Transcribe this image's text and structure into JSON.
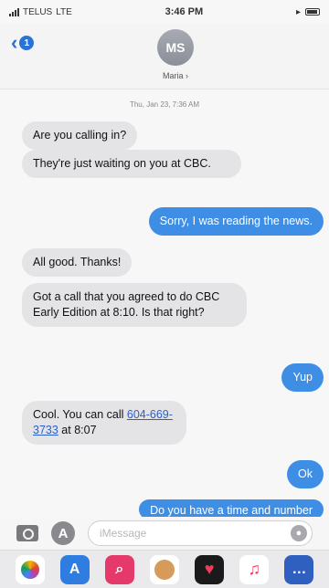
{
  "status_bar": {
    "carrier": "TELUS",
    "network": "LTE",
    "time": "3:46 PM"
  },
  "header": {
    "back_badge": "1",
    "avatar_initials": "MS",
    "contact_name": "Maria"
  },
  "timestamp": "Thu, Jan 23, 7:36 AM",
  "messages": [
    {
      "direction": "in",
      "text": "Are you calling in?"
    },
    {
      "direction": "in",
      "text": "They're just waiting on you at CBC."
    },
    {
      "direction": "out",
      "text": "Sorry, I was reading the news."
    },
    {
      "direction": "in",
      "text": "All good. Thanks!"
    },
    {
      "direction": "in",
      "text": "Got a call that you agreed to do CBC Early Edition at 8:10. Is that right?"
    },
    {
      "direction": "out",
      "text": "Yup"
    },
    {
      "direction": "in",
      "text_before": "Cool. You can call",
      "phone": "604-669-3733",
      "text_after": "at 8:07"
    },
    {
      "direction": "out",
      "text": "Ok"
    },
    {
      "direction": "out",
      "text": "Do you have a time and number"
    }
  ],
  "compose": {
    "placeholder": "iMessage"
  },
  "app_drawer": [
    {
      "icon": "photos-icon"
    },
    {
      "icon": "app-store-icon"
    },
    {
      "icon": "search-images-icon"
    },
    {
      "icon": "memoji-icon"
    },
    {
      "icon": "digital-touch-icon"
    },
    {
      "icon": "music-icon"
    },
    {
      "icon": "more-apps-icon"
    }
  ],
  "colors": {
    "outgoing_bubble": "#3f8ee6",
    "incoming_bubble": "#e4e4e7",
    "accent": "#2a73d6"
  }
}
